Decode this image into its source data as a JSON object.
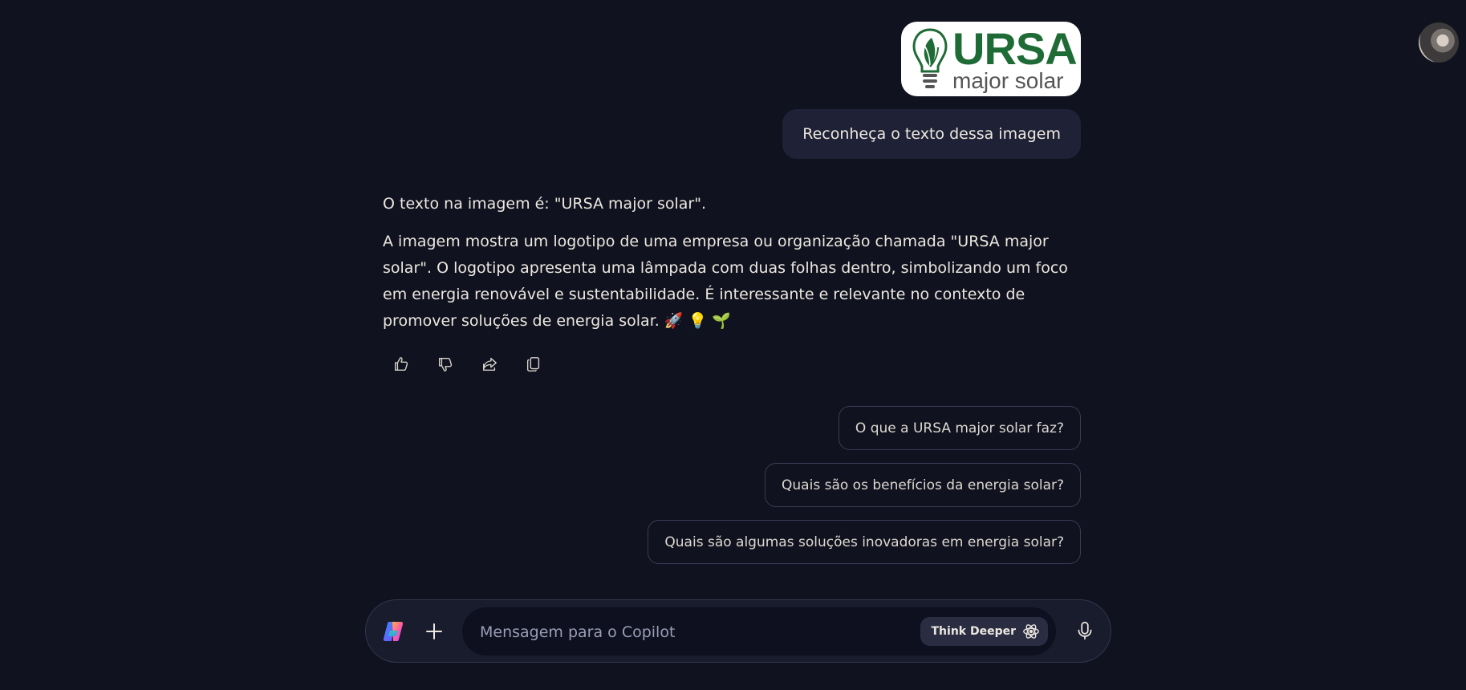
{
  "user_message": {
    "image": {
      "logo_main": "URSA",
      "logo_sub": "major solar"
    },
    "text": "Reconheça o texto dessa imagem"
  },
  "assistant_message": {
    "paragraph_1": "O texto na imagem é: \"URSA major solar\".",
    "paragraph_2": "A imagem mostra um logotipo de uma empresa ou organização chamada \"URSA major solar\". O logotipo apresenta uma lâmpada com duas folhas dentro, simbolizando um foco em energia renovável e sustentabilidade. É interessante e relevante no contexto de promover soluções de energia solar. 🚀 💡 🌱"
  },
  "actions": [
    "thumbs-up-icon",
    "thumbs-down-icon",
    "share-icon",
    "copy-icon"
  ],
  "suggestions": [
    "O que a URSA major solar faz?",
    "Quais são os benefícios da energia solar?",
    "Quais são algumas soluções inovadoras em energia solar?"
  ],
  "composer": {
    "placeholder": "Mensagem para o Copilot",
    "think_deeper_label": "Think Deeper"
  },
  "colors": {
    "background": "#10121f",
    "bubble": "#1f2236",
    "logo_green": "#1f6b36"
  }
}
